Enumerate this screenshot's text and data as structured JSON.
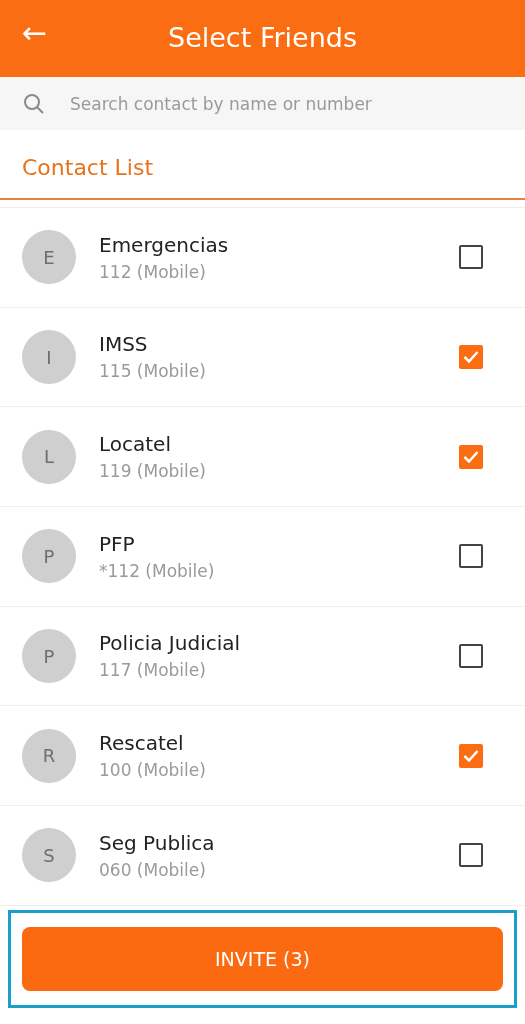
{
  "header": {
    "back_icon": "←",
    "title": "Select Friends"
  },
  "search": {
    "placeholder": "Search contact by name or number"
  },
  "section_title": "Contact List",
  "contacts": [
    {
      "initial": "E",
      "name": "Emergencias",
      "number": "112 (Mobile)",
      "checked": false
    },
    {
      "initial": "I",
      "name": "IMSS",
      "number": "115 (Mobile)",
      "checked": true
    },
    {
      "initial": "L",
      "name": "Locatel",
      "number": "119 (Mobile)",
      "checked": true
    },
    {
      "initial": "P",
      "name": "PFP",
      "number": "*112 (Mobile)",
      "checked": false
    },
    {
      "initial": "P",
      "name": "Policia Judicial",
      "number": "117 (Mobile)",
      "checked": false
    },
    {
      "initial": "R",
      "name": "Rescatel",
      "number": "100 (Mobile)",
      "checked": true
    },
    {
      "initial": "S",
      "name": "Seg Publica",
      "number": "060 (Mobile)",
      "checked": false
    }
  ],
  "invite_button": "INVITE (3)"
}
